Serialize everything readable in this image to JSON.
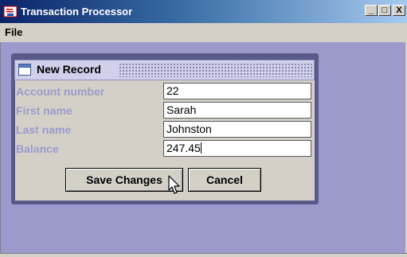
{
  "window": {
    "title": "Transaction Processor",
    "minimize": "_",
    "maximize": "□",
    "close": "X"
  },
  "menubar": {
    "file_label": "File"
  },
  "internal_frame": {
    "title": "New Record",
    "fields": [
      {
        "label": "Account number",
        "value": "22"
      },
      {
        "label": "First name",
        "value": "Sarah"
      },
      {
        "label": "Last name",
        "value": "Johnston"
      },
      {
        "label": "Balance",
        "value": "247.45"
      }
    ],
    "save_label": "Save Changes",
    "cancel_label": "Cancel"
  }
}
